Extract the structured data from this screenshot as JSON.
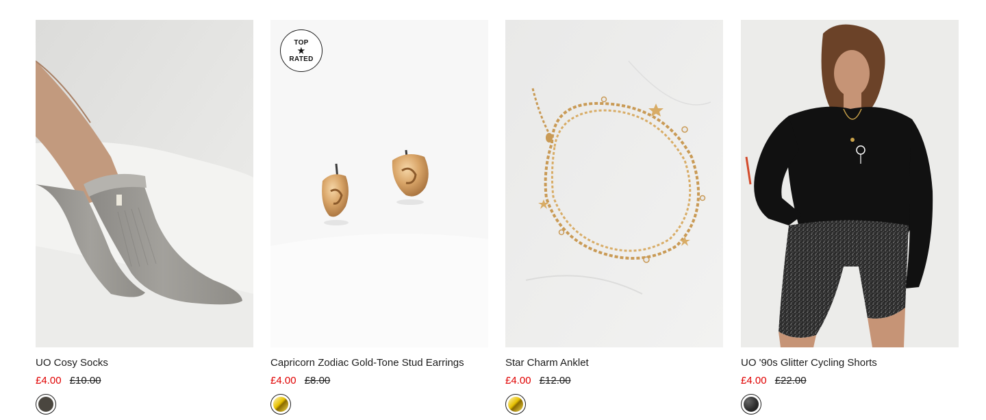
{
  "products": [
    {
      "title": "UO Cosy Socks",
      "sale_price": "£4.00",
      "original_price": "£10.00",
      "swatch_color": "#4a463f",
      "image_subject": "grey knit cosy socks on feet"
    },
    {
      "title": "Capricorn Zodiac Gold-Tone Stud Earrings",
      "sale_price": "£4.00",
      "original_price": "£8.00",
      "swatch_color": "gold",
      "image_subject": "gold-tone capricorn stud earrings",
      "badge": {
        "line1": "TOP",
        "star": "★",
        "line2": "RATED"
      }
    },
    {
      "title": "Star Charm Anklet",
      "sale_price": "£4.00",
      "original_price": "£12.00",
      "swatch_color": "gold",
      "image_subject": "gold chain anklet with star charms"
    },
    {
      "title": "UO '90s Glitter Cycling Shorts",
      "sale_price": "£4.00",
      "original_price": "£22.00",
      "swatch_color": "#2a2a2a",
      "image_subject": "model wearing black sweatshirt and glitter cycling shorts"
    }
  ]
}
